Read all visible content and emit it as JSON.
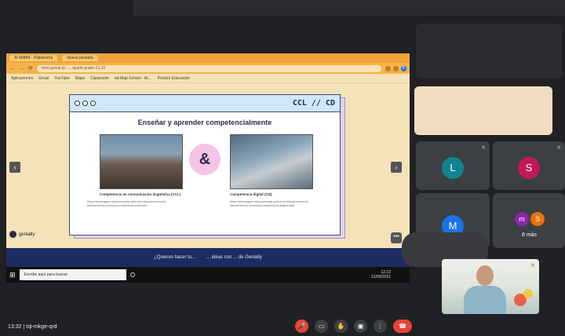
{
  "browser": {
    "tabs": [
      "Al 4MHM · Plataforma",
      "Nueva pestaña"
    ],
    "url": "view.genial.ly/....../guide-grado-21-22",
    "profile_initial": "K",
    "bookmarks": [
      "Aplicaciones",
      "Gmail",
      "YouTube",
      "Maps",
      "Classroom",
      "Iot-Map School · Ac...",
      "Portal's Educación"
    ]
  },
  "slide": {
    "header_label": "CCL // CD",
    "title": "Enseñar y aprender competencialmente",
    "amp": "&",
    "left_caption": "Competencia en comunicación lingüística (CCL)",
    "left_link": "https://educagob.educacionyfp.gob.es/curriculo/curriculo-lomloe/menu-curriculos-basicos/ed-infantil/...",
    "right_caption": "Competencia digital (CD)",
    "right_link": "https://educagob.educacionyfp.gob.es/curriculo/curriculo-lomloe/menu-curriculos-basicos/ed-digital.html",
    "brand": "genially",
    "footer_left": "¿Quieres hacer tu...",
    "footer_right": "... ideas con ... de Genially"
  },
  "taskbar": {
    "search_placeholder": "Escribe aquí para buscar",
    "time": "12:22",
    "date": "21/09/2021"
  },
  "participants": {
    "l_initial": "L",
    "s_initial": "S",
    "m_initial": "M",
    "m_small": "m",
    "s_small": "S",
    "more_count": "8 más",
    "colors": {
      "l": "#12848f",
      "s": "#c2185b",
      "m": "#1a73e8",
      "m_small": "#8e24aa",
      "s_small": "#e8710a"
    }
  },
  "meeting": {
    "time": "13:32",
    "code": "tqi-mkge-qrd"
  }
}
